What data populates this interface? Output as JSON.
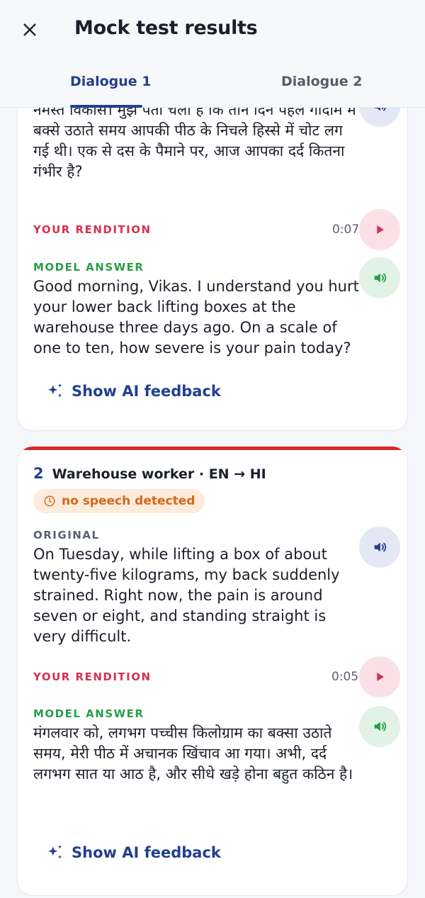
{
  "header": {
    "title": "Mock test results",
    "close_icon": "close-icon"
  },
  "tabs": [
    {
      "label": "Dialogue 1",
      "active": true
    },
    {
      "label": "Dialogue 2",
      "active": false
    }
  ],
  "colors": {
    "accent_blue": "#23408e",
    "rendition_red": "#d63151",
    "model_green": "#2a9d48",
    "badge_orange": "#d8661a",
    "card_accent_red": "#d62a2a"
  },
  "cards": [
    {
      "original_text": "नमस्ते विकास। मुझे पता चला है कि तीन दिन पहले गोदाम में बक्से उठाते समय आपकी पीठ के निचले हिस्से में चोट लग गई थी। एक से दस के पैमाने पर, आज आपका दर्द कितना गंभीर है?",
      "rendition_label": "YOUR RENDITION",
      "rendition_duration": "0:07",
      "model_label": "MODEL ANSWER",
      "model_text": "Good morning, Vikas. I understand you hurt your lower back lifting boxes at the warehouse three days ago. On a scale of one to ten, how severe is your pain today?",
      "feedback_label": "Show AI feedback"
    },
    {
      "number": "2",
      "title": "Warehouse worker · EN → HI",
      "badge": "no speech detected",
      "original_label": "ORIGINAL",
      "original_text": "On Tuesday, while lifting a box of about twenty-five kilograms, my back suddenly strained. Right now, the pain is around seven or eight, and standing straight is very difficult.",
      "rendition_label": "YOUR RENDITION",
      "rendition_duration": "0:05",
      "model_label": "MODEL ANSWER",
      "model_text": "मंगलवार को, लगभग पच्चीस किलोग्राम का बक्सा उठाते समय, मेरी पीठ में अचानक खिंचाव आ गया। अभी, दर्द लगभग सात या आठ है, और सीधे खड़े होना बहुत कठिन है।",
      "feedback_label": "Show AI feedback"
    }
  ]
}
